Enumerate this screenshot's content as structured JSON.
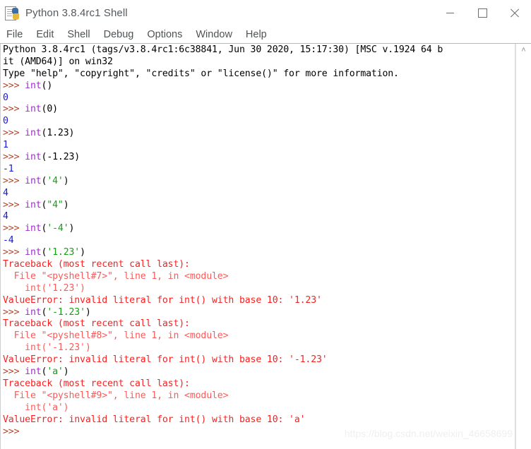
{
  "window": {
    "title": "Python 3.8.4rc1 Shell",
    "icon": "idle-python-icon",
    "controls": {
      "minimize": "minimize-icon",
      "maximize": "maximize-icon",
      "close": "close-icon"
    }
  },
  "menubar": {
    "items": [
      {
        "label": "File"
      },
      {
        "label": "Edit"
      },
      {
        "label": "Shell"
      },
      {
        "label": "Debug"
      },
      {
        "label": "Options"
      },
      {
        "label": "Window"
      },
      {
        "label": "Help"
      }
    ]
  },
  "scrollbar": {
    "up_arrow": "˄"
  },
  "watermark": {
    "text": "https://blog.csdn.net/weixin_46658699"
  },
  "shell": {
    "lines": [
      {
        "id": "banner-1",
        "segments": [
          {
            "cls": "t-plain",
            "text": "Python 3.8.4rc1 (tags/v3.8.4rc1:6c38841, Jun 30 2020, 15:17:30) [MSC v.1924 64 b"
          }
        ]
      },
      {
        "id": "banner-2",
        "segments": [
          {
            "cls": "t-plain",
            "text": "it (AMD64)] on win32"
          }
        ]
      },
      {
        "id": "banner-3",
        "segments": [
          {
            "cls": "t-plain",
            "text": "Type \"help\", \"copyright\", \"credits\" or \"license()\" for more information."
          }
        ]
      },
      {
        "id": "input-1",
        "segments": [
          {
            "cls": "t-prompt",
            "text": ">>> "
          },
          {
            "cls": "t-builtin",
            "text": "int"
          },
          {
            "cls": "t-plain",
            "text": "()"
          }
        ]
      },
      {
        "id": "output-1",
        "segments": [
          {
            "cls": "t-output",
            "text": "0"
          }
        ]
      },
      {
        "id": "input-2",
        "segments": [
          {
            "cls": "t-prompt",
            "text": ">>> "
          },
          {
            "cls": "t-builtin",
            "text": "int"
          },
          {
            "cls": "t-plain",
            "text": "(0)"
          }
        ]
      },
      {
        "id": "output-2",
        "segments": [
          {
            "cls": "t-output",
            "text": "0"
          }
        ]
      },
      {
        "id": "input-3",
        "segments": [
          {
            "cls": "t-prompt",
            "text": ">>> "
          },
          {
            "cls": "t-builtin",
            "text": "int"
          },
          {
            "cls": "t-plain",
            "text": "(1.23)"
          }
        ]
      },
      {
        "id": "output-3",
        "segments": [
          {
            "cls": "t-output",
            "text": "1"
          }
        ]
      },
      {
        "id": "input-4",
        "segments": [
          {
            "cls": "t-prompt",
            "text": ">>> "
          },
          {
            "cls": "t-builtin",
            "text": "int"
          },
          {
            "cls": "t-plain",
            "text": "(-1.23)"
          }
        ]
      },
      {
        "id": "output-4",
        "segments": [
          {
            "cls": "t-output",
            "text": "-1"
          }
        ]
      },
      {
        "id": "input-5",
        "segments": [
          {
            "cls": "t-prompt",
            "text": ">>> "
          },
          {
            "cls": "t-builtin",
            "text": "int"
          },
          {
            "cls": "t-plain",
            "text": "("
          },
          {
            "cls": "t-string",
            "text": "'4'"
          },
          {
            "cls": "t-plain",
            "text": ")"
          }
        ]
      },
      {
        "id": "output-5",
        "segments": [
          {
            "cls": "t-output",
            "text": "4"
          }
        ]
      },
      {
        "id": "input-6",
        "segments": [
          {
            "cls": "t-prompt",
            "text": ">>> "
          },
          {
            "cls": "t-builtin",
            "text": "int"
          },
          {
            "cls": "t-plain",
            "text": "("
          },
          {
            "cls": "t-string",
            "text": "\"4\""
          },
          {
            "cls": "t-plain",
            "text": ")"
          }
        ]
      },
      {
        "id": "output-6",
        "segments": [
          {
            "cls": "t-output",
            "text": "4"
          }
        ]
      },
      {
        "id": "input-7",
        "segments": [
          {
            "cls": "t-prompt",
            "text": ">>> "
          },
          {
            "cls": "t-builtin",
            "text": "int"
          },
          {
            "cls": "t-plain",
            "text": "("
          },
          {
            "cls": "t-string",
            "text": "'-4'"
          },
          {
            "cls": "t-plain",
            "text": ")"
          }
        ]
      },
      {
        "id": "output-7",
        "segments": [
          {
            "cls": "t-output",
            "text": "-4"
          }
        ]
      },
      {
        "id": "input-8",
        "segments": [
          {
            "cls": "t-prompt",
            "text": ">>> "
          },
          {
            "cls": "t-builtin",
            "text": "int"
          },
          {
            "cls": "t-plain",
            "text": "("
          },
          {
            "cls": "t-string",
            "text": "'1.23'"
          },
          {
            "cls": "t-plain",
            "text": ")"
          }
        ]
      },
      {
        "id": "traceback-1-head",
        "segments": [
          {
            "cls": "t-err",
            "text": "Traceback (most recent call last):"
          }
        ]
      },
      {
        "id": "traceback-1-file",
        "segments": [
          {
            "cls": "t-errsoft",
            "text": "  File \"<pyshell#7>\", line 1, in <module>"
          }
        ]
      },
      {
        "id": "traceback-1-src",
        "segments": [
          {
            "cls": "t-errsoft",
            "text": "    int('1.23')"
          }
        ]
      },
      {
        "id": "traceback-1-msg",
        "segments": [
          {
            "cls": "t-err",
            "text": "ValueError: invalid literal for int() with base 10: '1.23'"
          }
        ]
      },
      {
        "id": "input-9",
        "segments": [
          {
            "cls": "t-prompt",
            "text": ">>> "
          },
          {
            "cls": "t-builtin",
            "text": "int"
          },
          {
            "cls": "t-plain",
            "text": "("
          },
          {
            "cls": "t-string",
            "text": "'-1.23'"
          },
          {
            "cls": "t-plain",
            "text": ")"
          }
        ]
      },
      {
        "id": "traceback-2-head",
        "segments": [
          {
            "cls": "t-err",
            "text": "Traceback (most recent call last):"
          }
        ]
      },
      {
        "id": "traceback-2-file",
        "segments": [
          {
            "cls": "t-errsoft",
            "text": "  File \"<pyshell#8>\", line 1, in <module>"
          }
        ]
      },
      {
        "id": "traceback-2-src",
        "segments": [
          {
            "cls": "t-errsoft",
            "text": "    int('-1.23')"
          }
        ]
      },
      {
        "id": "traceback-2-msg",
        "segments": [
          {
            "cls": "t-err",
            "text": "ValueError: invalid literal for int() with base 10: '-1.23'"
          }
        ]
      },
      {
        "id": "input-10",
        "segments": [
          {
            "cls": "t-prompt",
            "text": ">>> "
          },
          {
            "cls": "t-builtin",
            "text": "int"
          },
          {
            "cls": "t-plain",
            "text": "("
          },
          {
            "cls": "t-string",
            "text": "'a'"
          },
          {
            "cls": "t-plain",
            "text": ")"
          }
        ]
      },
      {
        "id": "traceback-3-head",
        "segments": [
          {
            "cls": "t-err",
            "text": "Traceback (most recent call last):"
          }
        ]
      },
      {
        "id": "traceback-3-file",
        "segments": [
          {
            "cls": "t-errsoft",
            "text": "  File \"<pyshell#9>\", line 1, in <module>"
          }
        ]
      },
      {
        "id": "traceback-3-src",
        "segments": [
          {
            "cls": "t-errsoft",
            "text": "    int('a')"
          }
        ]
      },
      {
        "id": "traceback-3-msg",
        "segments": [
          {
            "cls": "t-err",
            "text": "ValueError: invalid literal for int() with base 10: 'a'"
          }
        ]
      },
      {
        "id": "prompt-final",
        "segments": [
          {
            "cls": "t-prompt",
            "text": ">>> "
          }
        ]
      }
    ]
  }
}
